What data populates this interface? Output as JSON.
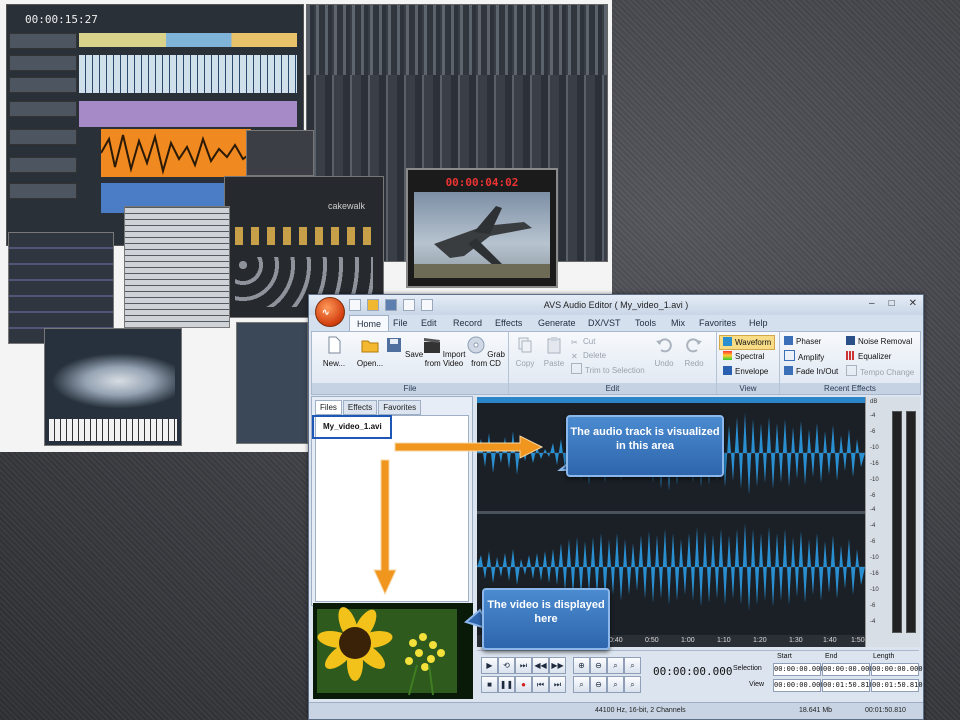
{
  "collage": {
    "daw_timer": "00:00:15:27",
    "video_timecode": "00:00:04:02",
    "logo": "cakewalk"
  },
  "app": {
    "title": "AVS Audio Editor  ( My_video_1.avi )",
    "window_buttons": [
      "–",
      "□",
      "✕"
    ],
    "menu": [
      "Home",
      "File",
      "Edit",
      "Record",
      "Effects",
      "Generate",
      "DX/VST",
      "Tools",
      "Mix",
      "Favorites",
      "Help"
    ],
    "active_menu": "Home",
    "ribbon": {
      "file_group": {
        "label": "File",
        "buttons": [
          "New...",
          "Open...",
          "Save",
          "Import from Video",
          "Grab from CD"
        ]
      },
      "edit_group": {
        "label": "Edit",
        "big": [
          "Copy",
          "Paste",
          "Undo",
          "Redo"
        ],
        "small": [
          "Cut",
          "Delete",
          "Trim to Selection"
        ]
      },
      "view_group": {
        "label": "View",
        "items": [
          "Waveform",
          "Spectral",
          "Envelope"
        ]
      },
      "recent_group": {
        "label": "Recent Effects",
        "items": [
          "Phaser",
          "Amplify",
          "Fade In/Out",
          "Noise Removal",
          "Equalizer",
          "Tempo Change"
        ]
      }
    },
    "left_tabs": [
      "Files",
      "Effects",
      "Favorites"
    ],
    "active_tab": "Files",
    "file_item": "My_video_1.avi",
    "time_ticks": [
      "0:40",
      "0:50",
      "1:00",
      "1:10",
      "1:20",
      "1:30",
      "1:40",
      "1:50"
    ],
    "db_ticks": [
      "dB",
      "-4",
      "-6",
      "-10",
      "-16",
      "-10",
      "-6",
      "-4",
      "-4",
      "-6",
      "-10",
      "-16",
      "-10",
      "-6",
      "-4"
    ],
    "transport": {
      "clock": "00:00:00.000",
      "headers": [
        "Start",
        "End",
        "Length"
      ],
      "selection_label": "Selection",
      "view_label": "View",
      "selection": [
        "00:00:00.000",
        "00:00:00.000",
        "00:00:00.000"
      ],
      "view": [
        "00:00:00.000",
        "00:01:50.810",
        "00:01:50.810"
      ]
    },
    "status": {
      "format": "44100 Hz, 16-bit, 2 Channels",
      "size": "18.641 Mb",
      "duration": "00:01:50.810"
    }
  },
  "callouts": {
    "audio": "The audio track is visualized in this area",
    "video": "The video is displayed here"
  },
  "colors": {
    "waveform": "#2a8fd0",
    "callout": "#3a76c0",
    "arrow": "#f0961e",
    "highlight": "#1f57b6"
  }
}
